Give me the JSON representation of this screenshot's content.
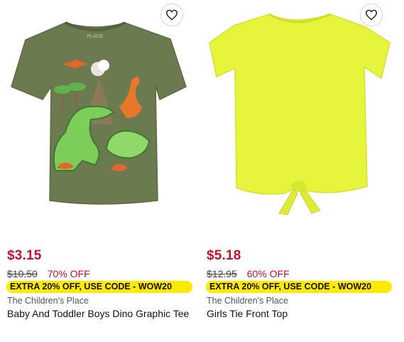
{
  "products": [
    {
      "price": "$3.15",
      "original_price": "$10.50",
      "discount": "70% OFF",
      "promo": "EXTRA 20% OFF, USE CODE - WOW20",
      "brand": "The Children's Place",
      "title": "Baby And Toddler Boys Dino Graphic Tee",
      "shirt_color": "#6b7a4f",
      "shirt_label": "PLACE"
    },
    {
      "price": "$5.18",
      "original_price": "$12.95",
      "discount": "60% OFF",
      "promo": "EXTRA 20% OFF, USE CODE - WOW20",
      "brand": "The Children's Place",
      "title": "Girls Tie Front Top",
      "shirt_color": "#e6f53c"
    }
  ],
  "colors": {
    "price": "#c8102e",
    "promo_bg": "#ffea00"
  },
  "icons": {
    "favorite": "heart-outline-icon"
  }
}
